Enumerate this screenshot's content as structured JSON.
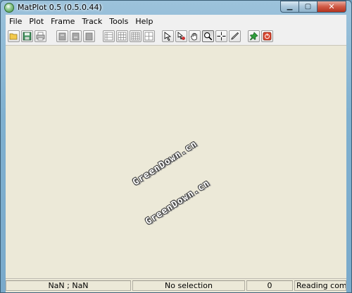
{
  "window": {
    "title": "MatPlot 0.5 (0.5.0.44)"
  },
  "menus": [
    "File",
    "Plot",
    "Frame",
    "Track",
    "Tools",
    "Help"
  ],
  "toolbar": {
    "buttons": [
      {
        "icon": "open-folder-icon"
      },
      {
        "icon": "save-icon"
      },
      {
        "icon": "print-icon"
      },
      {
        "icon": "frame-add-icon"
      },
      {
        "icon": "frame-copy-icon"
      },
      {
        "icon": "frame-delete-icon"
      },
      {
        "icon": "layout-list-icon"
      },
      {
        "icon": "grid-3x3-icon"
      },
      {
        "icon": "grid-4x4-icon"
      },
      {
        "icon": "grid-2x2-icon"
      },
      {
        "icon": "select-arrow-icon"
      },
      {
        "icon": "pointer-pick-icon"
      },
      {
        "icon": "pan-hand-icon"
      },
      {
        "icon": "zoom-icon",
        "pressed": true
      },
      {
        "icon": "crosshair-icon"
      },
      {
        "icon": "draw-pen-icon"
      },
      {
        "icon": "pin-icon"
      },
      {
        "icon": "stop-icon"
      }
    ]
  },
  "watermarks": [
    "GreenDown.cn",
    "GreenDown.cn"
  ],
  "status": {
    "coords": "NaN ; NaN",
    "selection": "No selection",
    "count": "0",
    "message": "Reading com"
  },
  "colors": {
    "canvas": "#ece9d8",
    "pin": "#2f9e3a",
    "stop": "#d9462e"
  }
}
